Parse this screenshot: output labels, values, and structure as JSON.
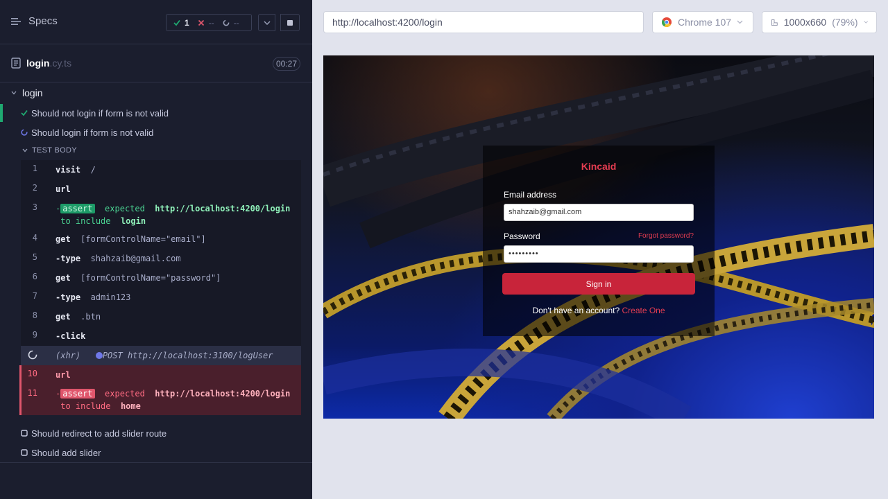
{
  "reporter": {
    "specs_label": "Specs",
    "stats": {
      "passed": "1",
      "failed": "--",
      "pending": "--"
    },
    "spec": {
      "name": "login",
      "ext": ".cy.ts",
      "duration": "00:27"
    },
    "suite": "login",
    "tests": [
      {
        "label": "Should not login if form is not valid",
        "state": "passed"
      },
      {
        "label": "Should login if form is not valid",
        "state": "running"
      },
      {
        "label": "Should redirect to add slider route",
        "state": "pending"
      },
      {
        "label": "Should add slider",
        "state": "pending"
      }
    ],
    "test_body_label": "TEST BODY",
    "commands": [
      {
        "n": "1",
        "name": "visit",
        "arg": "/"
      },
      {
        "n": "2",
        "name": "url",
        "arg": ""
      },
      {
        "n": "3",
        "prefix": "-",
        "badge": "assert",
        "text1": "expected",
        "value1": "http://localhost:4200/login",
        "text2": "to",
        "text3": "include",
        "value2": "login"
      },
      {
        "n": "4",
        "name": "get",
        "arg": "[formControlName=\"email\"]"
      },
      {
        "n": "5",
        "name": "-type",
        "arg": "shahzaib@gmail.com"
      },
      {
        "n": "6",
        "name": "get",
        "arg": "[formControlName=\"password\"]"
      },
      {
        "n": "7",
        "name": "-type",
        "arg": "admin123"
      },
      {
        "n": "8",
        "name": "get",
        "arg": ".btn"
      },
      {
        "n": "9",
        "name": "-click",
        "arg": ""
      },
      {
        "xhr_label": "(xhr)",
        "method": "POST",
        "url": "http://localhost:3100/logUser"
      },
      {
        "n": "10",
        "name": "url",
        "arg": ""
      },
      {
        "n": "11",
        "prefix": "-",
        "badge": "assert",
        "text1": "expected",
        "value1": "http://localhost:4200/login",
        "text2": "to",
        "text3": "include",
        "value2": "home"
      }
    ]
  },
  "browser": {
    "url": "http://localhost:4200/login",
    "browser_name": "Chrome 107",
    "viewport": "1000x660",
    "zoom": "(79%)"
  },
  "app": {
    "brand": "Kincaid",
    "email_label": "Email address",
    "email_value": "shahzaib@gmail.com",
    "password_label": "Password",
    "password_value": "•••••••••",
    "forgot": "Forgot password?",
    "signin": "Sign in",
    "no_account": "Don't have an account?",
    "create": "Create One"
  },
  "colors": {
    "pass": "#1fa971",
    "fail": "#e0566c",
    "brand": "#e43d51",
    "button": "#c8243a",
    "panel": "#1b1e2e"
  },
  "icons": [
    "specs-menu-icon",
    "check-icon",
    "x-icon",
    "pending-spinner-icon",
    "chevron-down-icon",
    "stop-icon",
    "document-icon",
    "chrome-icon",
    "viewport-icon"
  ]
}
